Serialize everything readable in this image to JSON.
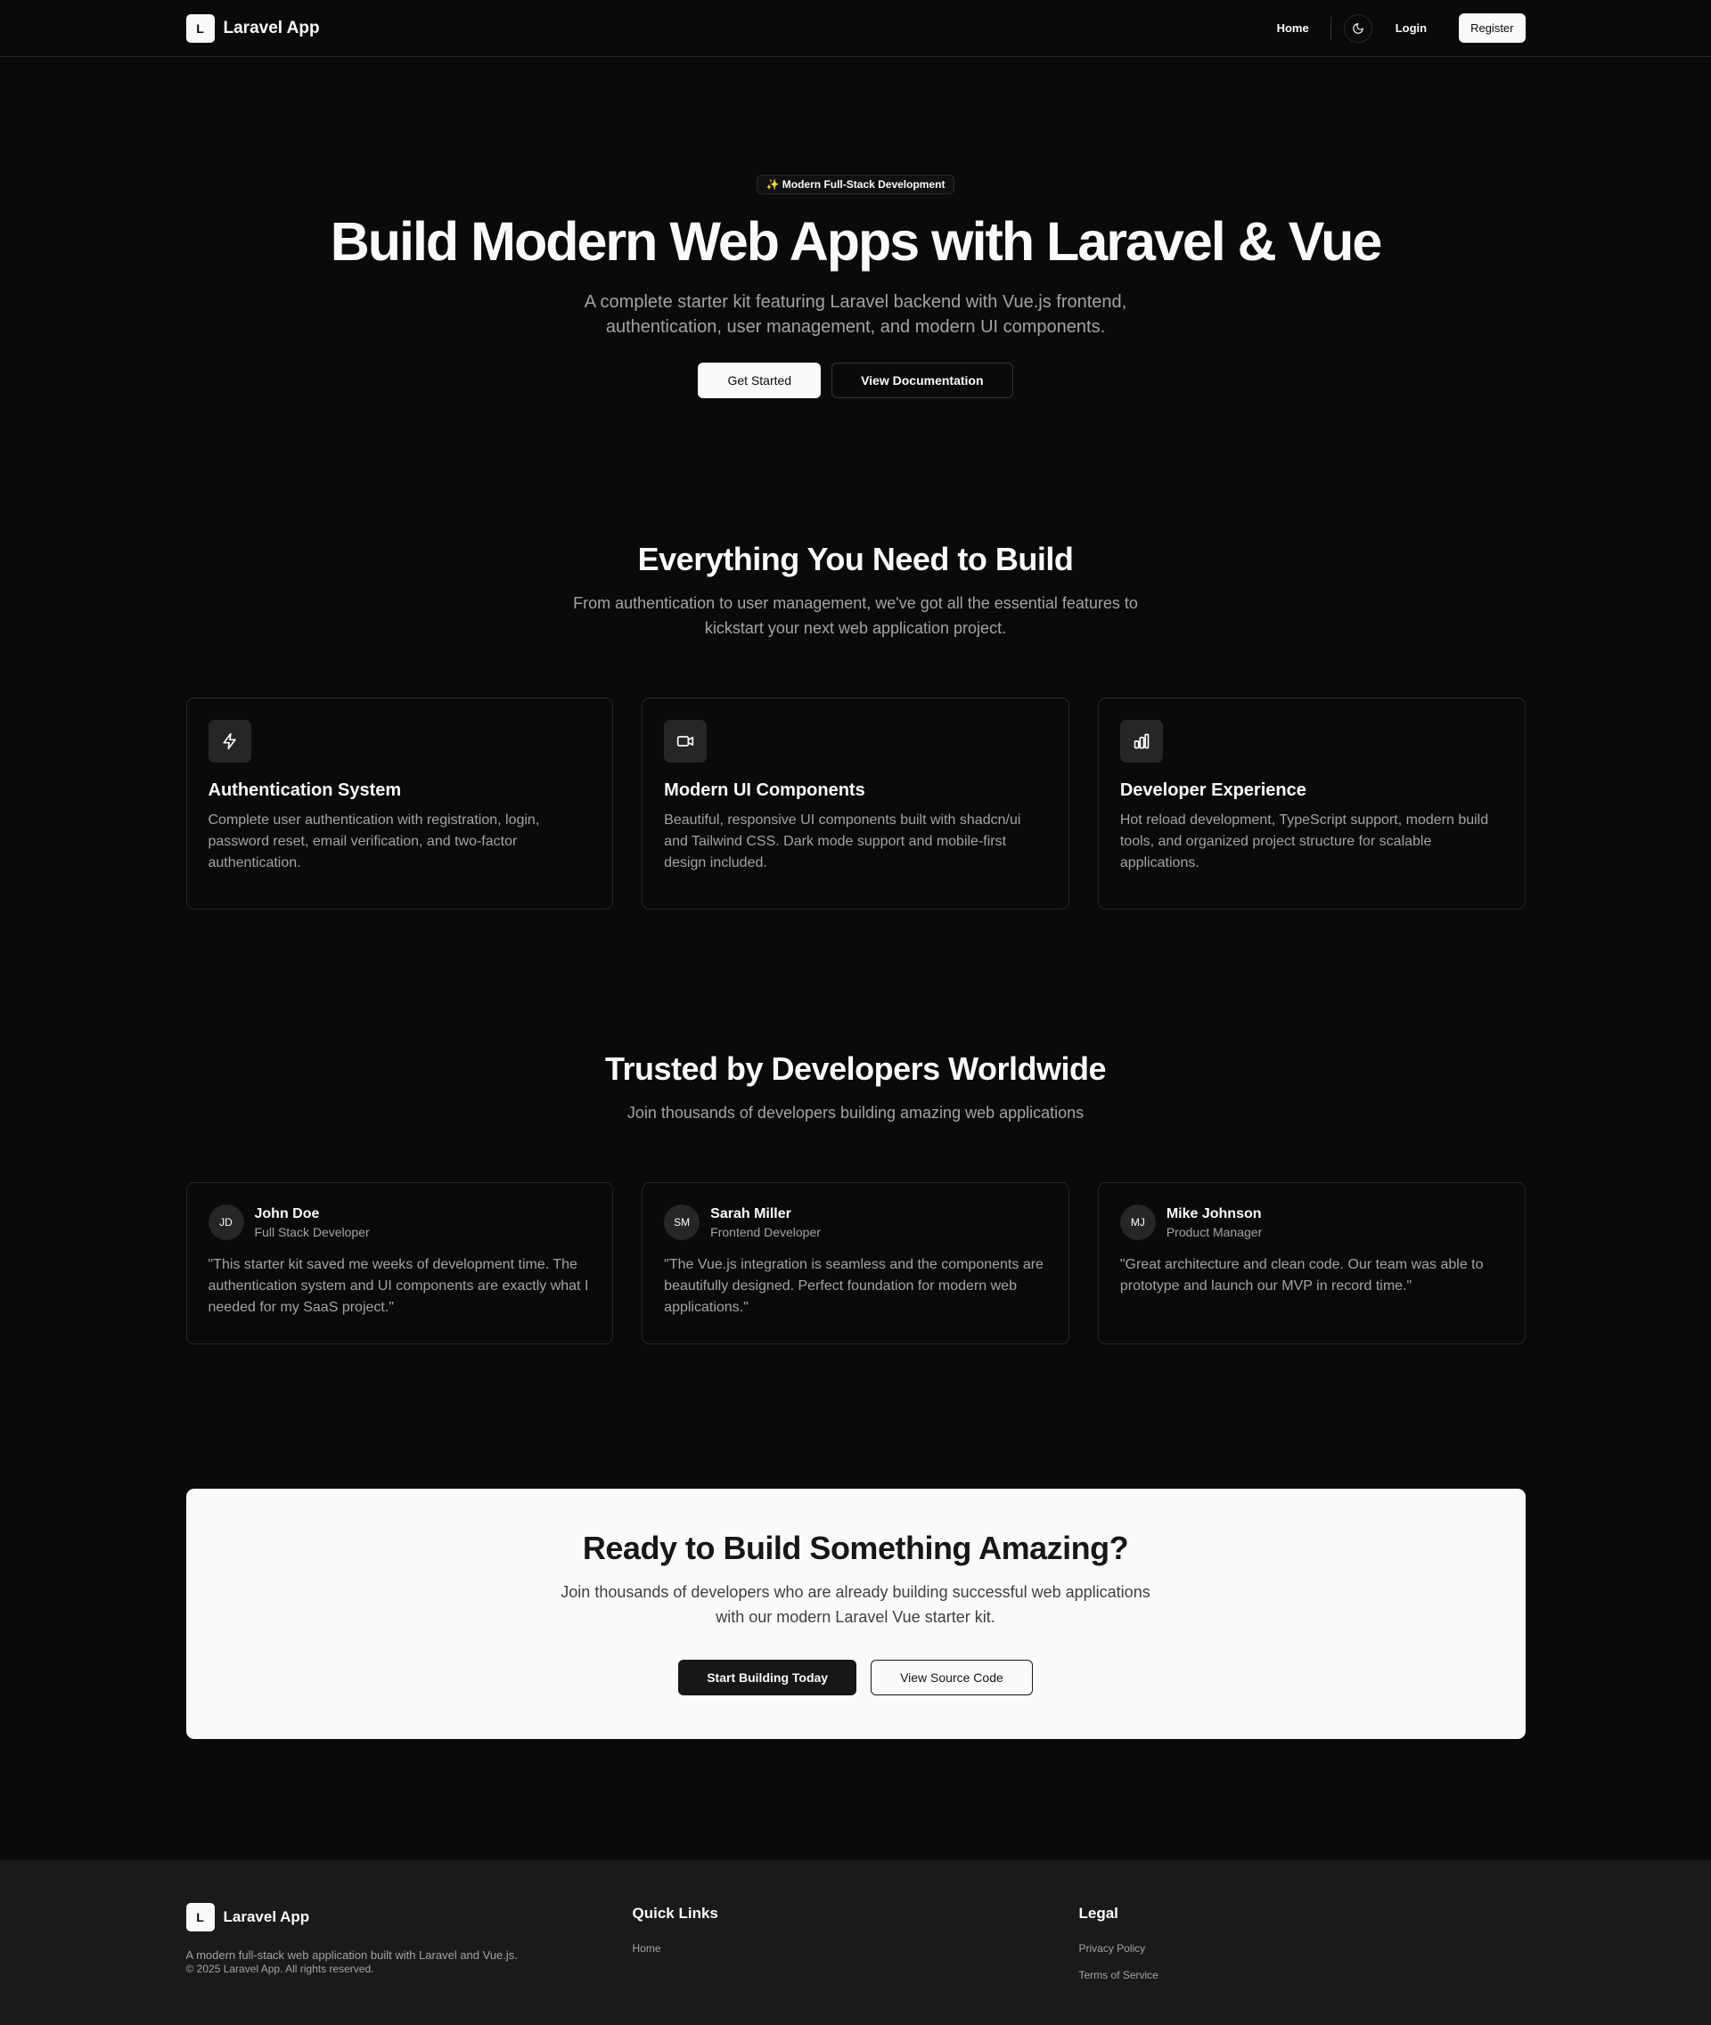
{
  "header": {
    "logo_letter": "L",
    "brand": "Laravel App",
    "nav": {
      "home": "Home",
      "login": "Login",
      "register": "Register"
    }
  },
  "hero": {
    "badge": "✨ Modern Full-Stack Development",
    "title": "Build Modern Web Apps with Laravel & Vue",
    "subtitle": "A complete starter kit featuring Laravel backend with Vue.js frontend, authentication, user management, and modern UI components.",
    "primary_button": "Get Started",
    "secondary_button": "View Documentation"
  },
  "features": {
    "title": "Everything You Need to Build",
    "subtitle": "From authentication to user management, we've got all the essential features to kickstart your next web application project.",
    "items": [
      {
        "icon": "lightning-icon",
        "title": "Authentication System",
        "description": "Complete user authentication with registration, login, password reset, email verification, and two-factor authentication."
      },
      {
        "icon": "video-icon",
        "title": "Modern UI Components",
        "description": "Beautiful, responsive UI components built with shadcn/ui and Tailwind CSS. Dark mode support and mobile-first design included."
      },
      {
        "icon": "bar-chart-icon",
        "title": "Developer Experience",
        "description": "Hot reload development, TypeScript support, modern build tools, and organized project structure for scalable applications."
      }
    ]
  },
  "testimonials": {
    "title": "Trusted by Developers Worldwide",
    "subtitle": "Join thousands of developers building amazing web applications",
    "items": [
      {
        "initials": "JD",
        "name": "John Doe",
        "role": "Full Stack Developer",
        "quote": "\"This starter kit saved me weeks of development time. The authentication system and UI components are exactly what I needed for my SaaS project.\""
      },
      {
        "initials": "SM",
        "name": "Sarah Miller",
        "role": "Frontend Developer",
        "quote": "\"The Vue.js integration is seamless and the components are beautifully designed. Perfect foundation for modern web applications.\""
      },
      {
        "initials": "MJ",
        "name": "Mike Johnson",
        "role": "Product Manager",
        "quote": "\"Great architecture and clean code. Our team was able to prototype and launch our MVP in record time.\""
      }
    ]
  },
  "cta": {
    "title": "Ready to Build Something Amazing?",
    "subtitle": "Join thousands of developers who are already building successful web applications with our modern Laravel Vue starter kit.",
    "primary_button": "Start Building Today",
    "secondary_button": "View Source Code"
  },
  "footer": {
    "logo_letter": "L",
    "brand": "Laravel App",
    "description": "A modern full-stack web application built with Laravel and Vue.js.",
    "copyright": "© 2025 Laravel App. All rights reserved.",
    "quick_links": {
      "heading": "Quick Links",
      "links": [
        "Home"
      ]
    },
    "legal": {
      "heading": "Legal",
      "links": [
        "Privacy Policy",
        "Terms of Service"
      ]
    }
  },
  "colors": {
    "background": "#0a0a0a",
    "foreground": "#fafafa",
    "muted": "#a3a3a3",
    "border": "#262626",
    "footer_bg": "#1a1a1a"
  }
}
